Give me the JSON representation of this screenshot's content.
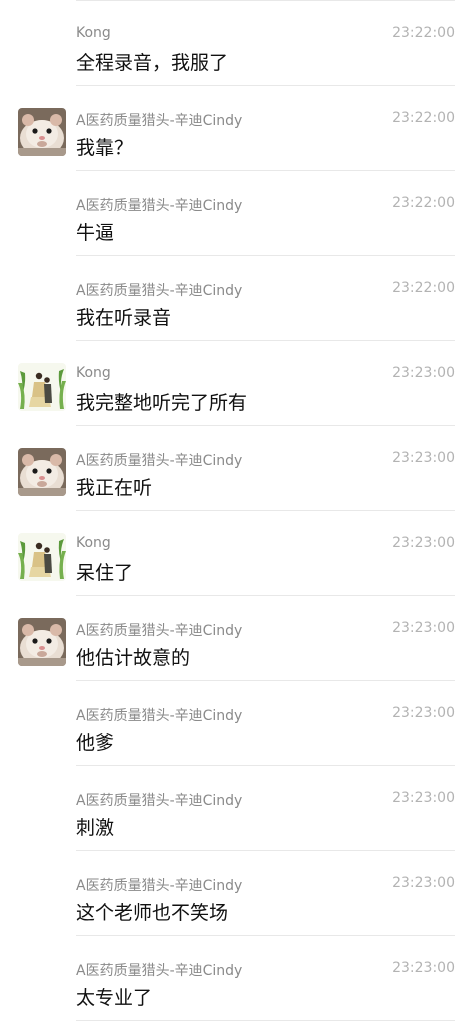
{
  "messages": [
    {
      "sender": "Kong",
      "time": "23:22:00",
      "text": "全程录音，我服了",
      "avatar": "none"
    },
    {
      "sender": "A医药质量猎头-辛迪Cindy",
      "time": "23:22:00",
      "text": "我靠？",
      "avatar": "hamster"
    },
    {
      "sender": "A医药质量猎头-辛迪Cindy",
      "time": "23:22:00",
      "text": "牛逼",
      "avatar": "none"
    },
    {
      "sender": "A医药质量猎头-辛迪Cindy",
      "time": "23:22:00",
      "text": "我在听录音",
      "avatar": "none"
    },
    {
      "sender": "Kong",
      "time": "23:23:00",
      "text": "我完整地听完了所有",
      "avatar": "couple"
    },
    {
      "sender": "A医药质量猎头-辛迪Cindy",
      "time": "23:23:00",
      "text": "我正在听",
      "avatar": "hamster"
    },
    {
      "sender": "Kong",
      "time": "23:23:00",
      "text": "呆住了",
      "avatar": "couple"
    },
    {
      "sender": "A医药质量猎头-辛迪Cindy",
      "time": "23:23:00",
      "text": "他估计故意的",
      "avatar": "hamster"
    },
    {
      "sender": "A医药质量猎头-辛迪Cindy",
      "time": "23:23:00",
      "text": "他爹",
      "avatar": "none"
    },
    {
      "sender": "A医药质量猎头-辛迪Cindy",
      "time": "23:23:00",
      "text": "刺激",
      "avatar": "none"
    },
    {
      "sender": "A医药质量猎头-辛迪Cindy",
      "time": "23:23:00",
      "text": "这个老师也不笑场",
      "avatar": "none"
    },
    {
      "sender": "A医药质量猎头-辛迪Cindy",
      "time": "23:23:00",
      "text": "太专业了",
      "avatar": "none"
    }
  ]
}
